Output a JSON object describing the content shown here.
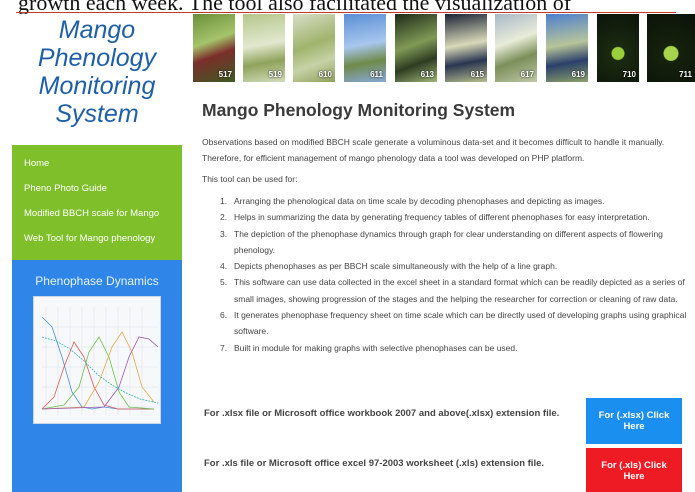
{
  "top_text": "growth each week. The tool also facilitated the visualization of",
  "logo": {
    "line1": "Mango",
    "line2": "Phenology",
    "line3": "Monitoring",
    "line4": "System"
  },
  "nav": {
    "items": [
      {
        "label": "Home"
      },
      {
        "label": "Pheno Photo Guide"
      },
      {
        "label": "Modified BBCH scale for Mango"
      },
      {
        "label": "Web Tool for Mango phenology"
      }
    ]
  },
  "dynamics": {
    "title": "Phenophase Dynamics"
  },
  "photos": [
    {
      "num": "517"
    },
    {
      "num": "519"
    },
    {
      "num": "610"
    },
    {
      "num": "611"
    },
    {
      "num": "613"
    },
    {
      "num": "615"
    },
    {
      "num": "617"
    },
    {
      "num": "619"
    },
    {
      "num": "710"
    },
    {
      "num": "711"
    }
  ],
  "main": {
    "title": "Mango Phenology Monitoring System",
    "intro": "Observations based on modified BBCH scale generate a voluminous data-set and it becomes difficult to handle it manually. Therefore, for efficient management of mango phenology data a tool was developed on PHP platform.",
    "use_label": "This tool can be used for:",
    "list": [
      {
        "n": "1.",
        "text": "Arranging the phenological data on time scale by decoding phenophases and depicting as images."
      },
      {
        "n": "2.",
        "text": "Helps in summarizing the data by generating frequency tables of different phenophases for easy interpretation."
      },
      {
        "n": "3.",
        "text": "The depiction of the phenophase dynamics through graph for clear understanding on different aspects of flowering phenology."
      },
      {
        "n": "4.",
        "text": "Depicts phenophases as per BBCH scale simultaneously with the help of a line graph."
      },
      {
        "n": "5.",
        "text": "This software can use data collected in the excel sheet in a standard format which can be readily depicted as a series of small images, showing progression of the stages and the helping the researcher for correction or cleaning of raw data."
      },
      {
        "n": "6.",
        "text": "It generates phenophase frequency sheet on time scale which can be directly used of developing graphs using graphical software."
      },
      {
        "n": "7.",
        "text": "Built in module for making graphs with selective phenophases can be used."
      }
    ]
  },
  "downloads": {
    "xlsx_text": "For .xlsx file or Microsoft office workbook 2007 and above(.xlsx) extension file.",
    "xlsx_button": "For (.xlsx) Click Here",
    "xls_text": "For .xls file or Microsoft office excel 97-2003 worksheet (.xls) extension file.",
    "xls_button": "For (.xls) Click Here"
  }
}
